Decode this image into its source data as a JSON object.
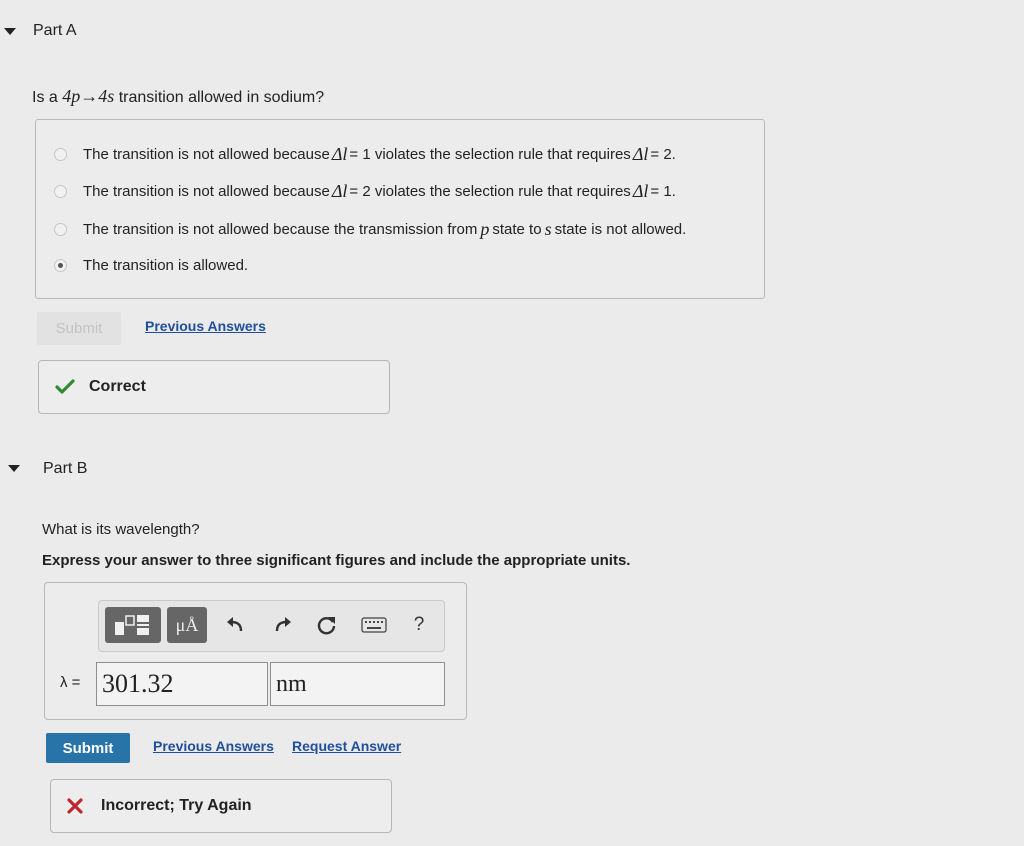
{
  "part_a": {
    "title": "Part A",
    "question_prefix": "Is a ",
    "question_math": "4p→4s",
    "question_suffix": " transition allowed in sodium?",
    "options": [
      {
        "before": "The transition is not allowed because ",
        "math1": "Δl",
        "middle": " = 1 violates the selection rule that requires ",
        "math2": "Δl",
        "after": " = 2."
      },
      {
        "before": "The transition is not allowed because ",
        "math1": "Δl",
        "middle": " = 2 violates the selection rule that requires ",
        "math2": "Δl",
        "after": " = 1."
      },
      {
        "before": "The transition is not allowed because the transmission from ",
        "math1": "p",
        "middle": " state to ",
        "math2": "s",
        "after": " state is not allowed."
      },
      {
        "text": "The transition is allowed."
      }
    ],
    "submit_label": "Submit",
    "previous_answers_label": "Previous Answers",
    "feedback": "Correct"
  },
  "part_b": {
    "title": "Part B",
    "question": "What is its wavelength?",
    "instruction": "Express your answer to three significant figures and include the appropriate units.",
    "toolbar": {
      "units_label": "μÅ",
      "help_label": "?"
    },
    "variable_label": "λ =",
    "value": "301.32",
    "units": "nm",
    "submit_label": "Submit",
    "previous_answers_label": "Previous Answers",
    "request_answer_label": "Request Answer",
    "feedback": "Incorrect; Try Again"
  },
  "colors": {
    "link": "#1f4f9b",
    "submit": "#2873a8",
    "correct": "#2e8b2e",
    "incorrect": "#c0272d"
  }
}
